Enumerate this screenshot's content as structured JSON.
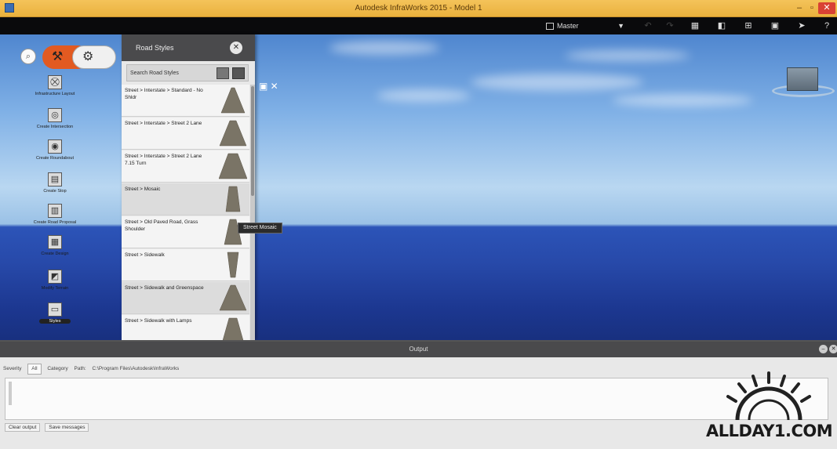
{
  "window": {
    "title": "Autodesk InfraWorks 2015 - Model 1",
    "minimize": "–",
    "maximize": "▫",
    "close": "✕"
  },
  "toolbar": {
    "model_selector": "Master",
    "icons": [
      "home-icon",
      "undo-icon",
      "redo-icon",
      "layers-icon",
      "view-icon",
      "split-icon",
      "window-icon",
      "pointer-icon",
      "help-icon"
    ]
  },
  "toolbox": {
    "items": [
      {
        "label": "Infrastructure Layout",
        "icon": "road-icon"
      },
      {
        "label": "Create Intersection",
        "icon": "intersection-icon"
      },
      {
        "label": "Create Roundabout",
        "icon": "roundabout-icon"
      },
      {
        "label": "Create Stop",
        "icon": "stop-icon"
      },
      {
        "label": "Create Road Proposal",
        "icon": "proposal-icon"
      },
      {
        "label": "Create Design",
        "icon": "design-icon"
      },
      {
        "label": "Modify Terrain",
        "icon": "terrain-icon"
      },
      {
        "label": "Styles",
        "icon": "styles-icon",
        "active": true
      }
    ]
  },
  "style_panel": {
    "title": "Road Styles",
    "search_placeholder": "Search Road Styles",
    "items": [
      {
        "text": "Street > Interstate > Standard - No Shldr"
      },
      {
        "text": "Street > Interstate > Street 2 Lane"
      },
      {
        "text": "Street > Interstate > Street 2 Lane 7.15 Turn"
      },
      {
        "text": "Street > Mosaic"
      },
      {
        "text": "Street > Old Paved Road, Grass Shoulder"
      },
      {
        "text": "Street > Sidewalk"
      },
      {
        "text": "Street > Sidewalk and Greenspace"
      },
      {
        "text": "Street > Sidewalk with Lamps"
      }
    ],
    "tooltip": "Street Mosaic"
  },
  "output": {
    "title": "Output",
    "filter_label": "Severity",
    "filter_value": "All",
    "level_label": "Category",
    "path_label": "Path:",
    "path_value": "C:\\Program Files\\Autodesk\\InfraWorks",
    "clear_button": "Clear output",
    "save_button": "Save messages"
  },
  "watermark": "ALLDAY1.COM"
}
